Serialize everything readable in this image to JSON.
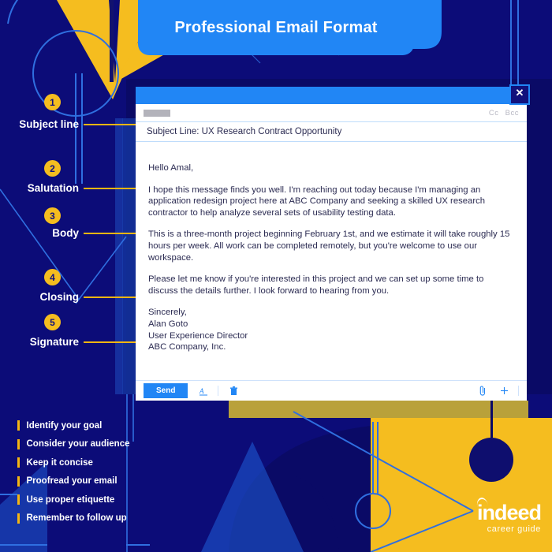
{
  "header": {
    "title": "Professional Email Format"
  },
  "annotations": [
    {
      "number": "1",
      "label": "Subject line"
    },
    {
      "number": "2",
      "label": "Salutation"
    },
    {
      "number": "3",
      "label": "Body"
    },
    {
      "number": "4",
      "label": "Closing"
    },
    {
      "number": "5",
      "label": "Signature"
    }
  ],
  "email_window": {
    "close_icon": "close-icon",
    "to_field": {
      "value": "",
      "redacted": true
    },
    "cc_label": "Cc",
    "bcc_label": "Bcc",
    "subject": "Subject Line: UX Research Contract Opportunity",
    "salutation": "Hello Amal,",
    "body_paragraphs": [
      "I hope this message finds you well. I'm reaching out today because I'm managing an application redesign project here at ABC Company and seeking a skilled UX research contractor to help analyze several sets of usability testing data.",
      "This is a three-month project beginning February 1st, and we estimate it will take roughly 15 hours per week. All work can be completed remotely, but you're welcome to use our workspace."
    ],
    "closing": "Please let me know if you're interested in this project and we can set up some time to discuss the details further. I look forward to hearing from you.",
    "signature": [
      "Sincerely,",
      "Alan Goto",
      "User Experience Director",
      "ABC Company, Inc."
    ],
    "toolbar": {
      "send_label": "Send",
      "format_icon": "format-text-icon",
      "delete_icon": "trash-icon",
      "attach_icon": "paperclip-icon",
      "more_icon": "plus-icon"
    }
  },
  "tips": [
    "Identify your goal",
    "Consider your audience",
    "Keep it concise",
    "Proofread your email",
    "Use proper etiquette",
    "Remember to follow up"
  ],
  "logo": {
    "word": "indeed",
    "tagline": "career guide"
  },
  "colors": {
    "navy": "#0c0c78",
    "deep_navy": "#11117c",
    "blue": "#2186f5",
    "yellow": "#f5bd1f",
    "gold_line": "#f5b612",
    "white": "#ffffff",
    "text_navy": "#2b2b52"
  }
}
